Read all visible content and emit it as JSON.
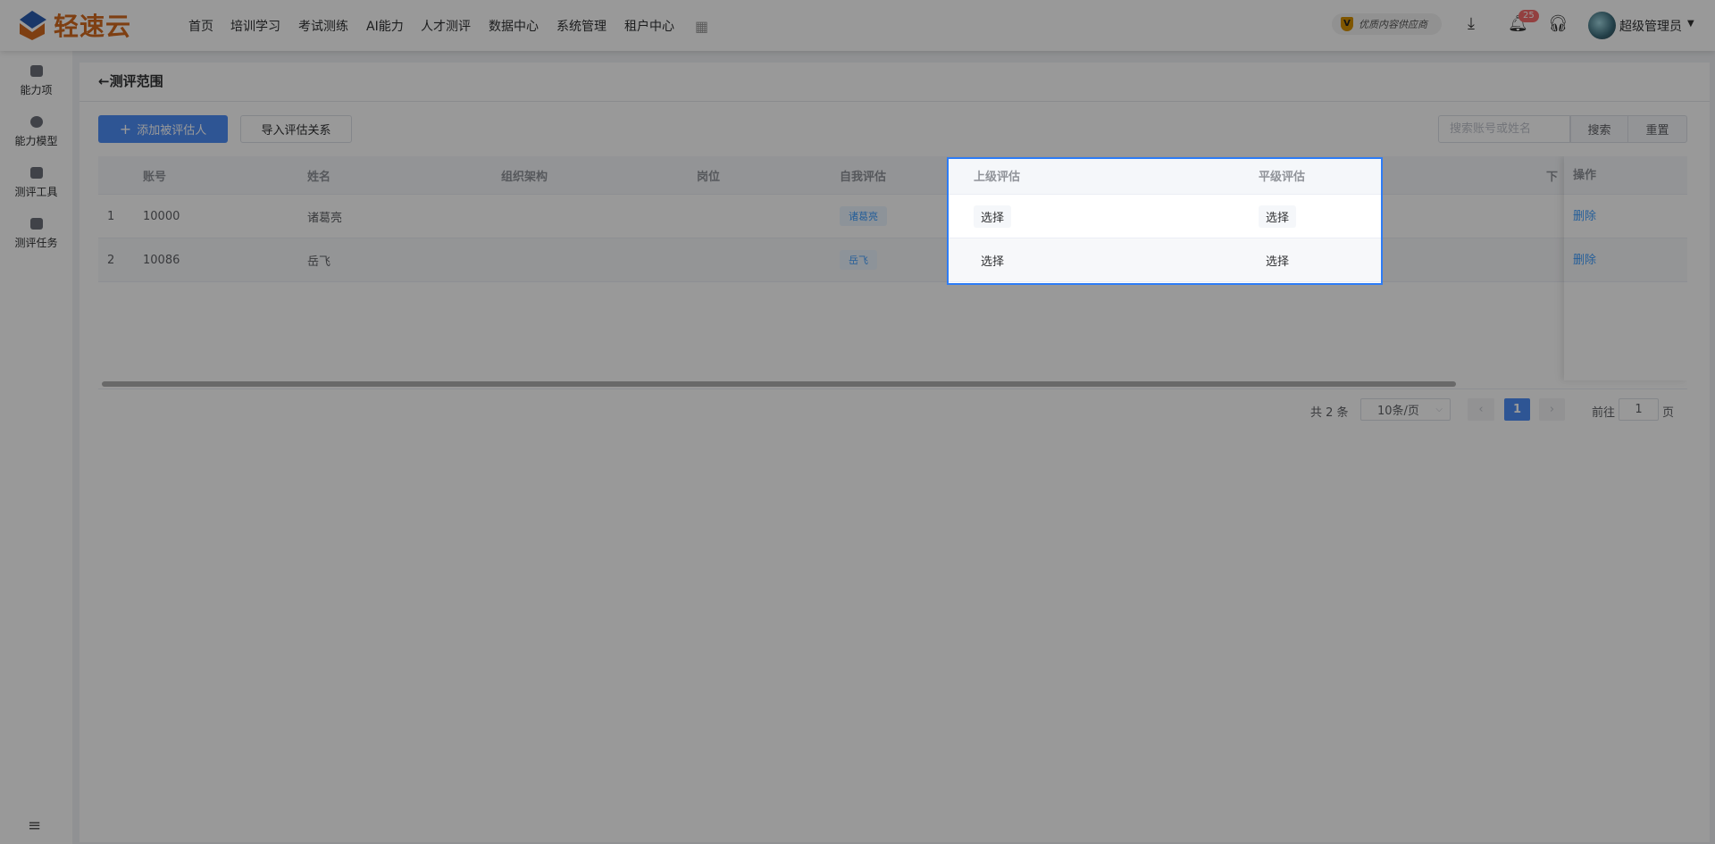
{
  "header": {
    "logo_text": "轻速云",
    "nav": [
      "首页",
      "培训学习",
      "考试测练",
      "AI能力",
      "人才测评",
      "数据中心",
      "系统管理",
      "租户中心"
    ],
    "provider_badge": "优质内容供应商",
    "notification_count": "25",
    "username": "超级管理员"
  },
  "sidebar": {
    "items": [
      {
        "label": "能力项"
      },
      {
        "label": "能力模型"
      },
      {
        "label": "测评工具"
      },
      {
        "label": "测评任务"
      }
    ]
  },
  "page": {
    "back_arrow": "←",
    "title": "测评范围",
    "add_button": "添加被评估人",
    "add_icon": "+",
    "import_button": "导入评估关系",
    "search_placeholder": "搜索账号或姓名",
    "search_button": "搜索",
    "reset_button": "重置"
  },
  "table": {
    "columns": [
      "",
      "账号",
      "姓名",
      "组织架构",
      "岗位",
      "自我评估",
      "上级评估",
      "平级评估",
      "下",
      "操作"
    ],
    "rows": [
      {
        "index": "1",
        "account": "10000",
        "name": "诸葛亮",
        "org": "",
        "position": "",
        "self": "诸葛亮",
        "superior": "选择",
        "peer": "选择",
        "action": "删除"
      },
      {
        "index": "2",
        "account": "10086",
        "name": "岳飞",
        "org": "",
        "position": "",
        "self": "岳飞",
        "superior": "选择",
        "peer": "选择",
        "action": "删除"
      }
    ]
  },
  "pagination": {
    "total": "共 2 条",
    "page_size": "10条/页",
    "current_page": "1",
    "goto_label": "前往",
    "goto_value": "1",
    "page_suffix": "页"
  },
  "colors": {
    "primary": "#4e8ef7",
    "highlight": "#2d7cf6",
    "badge": "#f56c6c",
    "logo": "#d2691e"
  }
}
